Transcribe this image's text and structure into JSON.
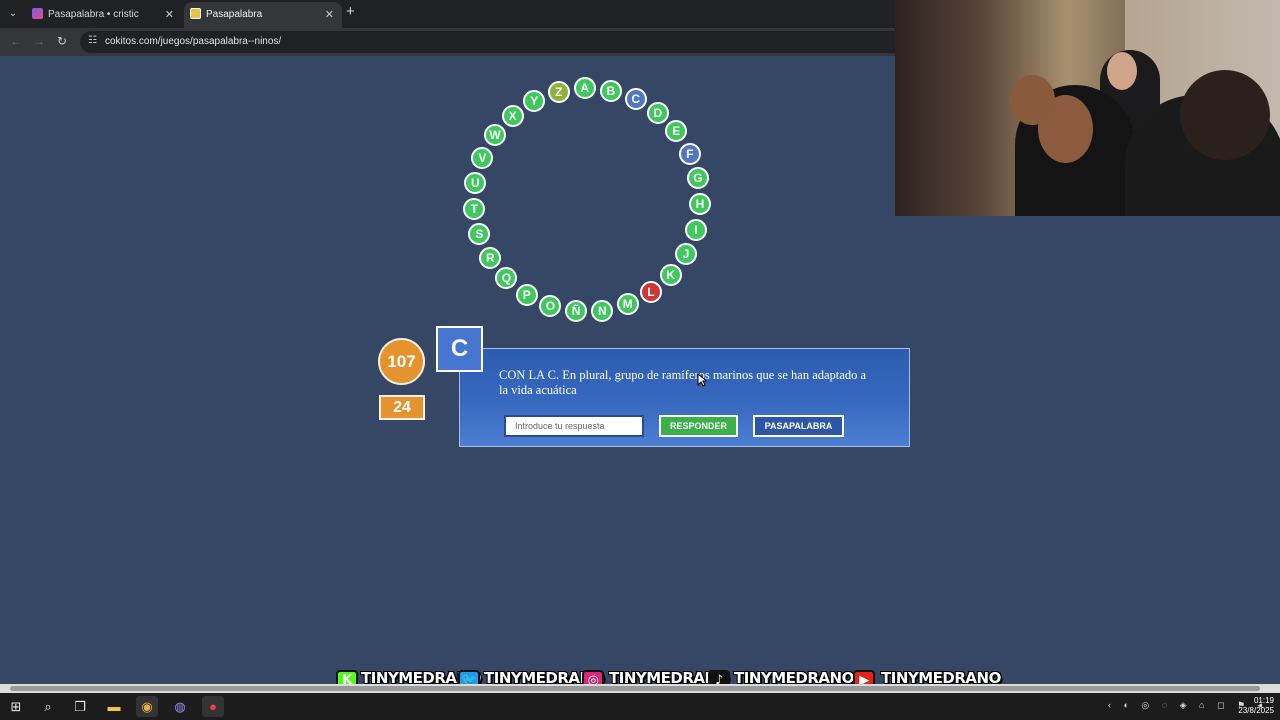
{
  "browser": {
    "tabs": [
      {
        "label": "Pasapalabra • cristic",
        "active": false
      },
      {
        "label": "Pasapalabra",
        "active": true
      }
    ],
    "url": "cokitos.com/juegos/pasapalabra--ninos/",
    "new_tab_label": "+",
    "close_label": "✕"
  },
  "game": {
    "letters": [
      {
        "letter": "A",
        "status": "pending"
      },
      {
        "letter": "B",
        "status": "pending"
      },
      {
        "letter": "C",
        "status": "current"
      },
      {
        "letter": "D",
        "status": "pending"
      },
      {
        "letter": "E",
        "status": "pending"
      },
      {
        "letter": "F",
        "status": "passed"
      },
      {
        "letter": "G",
        "status": "pending"
      },
      {
        "letter": "H",
        "status": "pending"
      },
      {
        "letter": "I",
        "status": "pending"
      },
      {
        "letter": "J",
        "status": "pending"
      },
      {
        "letter": "K",
        "status": "pending"
      },
      {
        "letter": "L",
        "status": "wrong"
      },
      {
        "letter": "M",
        "status": "pending"
      },
      {
        "letter": "N",
        "status": "pending"
      },
      {
        "letter": "Ñ",
        "status": "pending"
      },
      {
        "letter": "O",
        "status": "pending"
      },
      {
        "letter": "P",
        "status": "pending"
      },
      {
        "letter": "Q",
        "status": "pending"
      },
      {
        "letter": "R",
        "status": "pending"
      },
      {
        "letter": "S",
        "status": "pending"
      },
      {
        "letter": "T",
        "status": "pending"
      },
      {
        "letter": "U",
        "status": "pending"
      },
      {
        "letter": "V",
        "status": "pending"
      },
      {
        "letter": "W",
        "status": "pending"
      },
      {
        "letter": "X",
        "status": "pending"
      },
      {
        "letter": "Y",
        "status": "pending"
      },
      {
        "letter": "Z",
        "status": "olive"
      }
    ],
    "status_colors": {
      "pending": "#3fc85c",
      "current": "#4f77c4",
      "passed": "#4f77c4",
      "wrong": "#cf3737",
      "olive": "#8fb13a"
    },
    "score": "107",
    "timer": "24",
    "current_letter": "C",
    "question": "CON LA C. En plural, grupo de ramíferos marinos que se han adaptado a la vida acuática",
    "answer_placeholder": "Introduce tu respuesta",
    "answer_value": "",
    "responder_label": "RESPONDER",
    "pasapalabra_label": "PASAPALABRA"
  },
  "social": [
    {
      "icon": "kick-icon",
      "glyph": "K",
      "color": "#53fc18",
      "handle": "TINYMEDRANO"
    },
    {
      "icon": "twitter-icon",
      "glyph": "🐦",
      "color": "#1d9bf0",
      "handle": "TINYMEDRANO"
    },
    {
      "icon": "instagram-icon",
      "glyph": "◎",
      "color": "#d62976",
      "handle": "TINYMEDRANO"
    },
    {
      "icon": "tiktok-icon",
      "glyph": "♪",
      "color": "#111111",
      "handle": "TINYMEDRANOJR"
    },
    {
      "icon": "youtube-icon",
      "glyph": "▶",
      "color": "#e62117",
      "handle": "TINYMEDRANO"
    }
  ],
  "taskbar": {
    "time": "01:19",
    "date": "23/8/2025"
  }
}
